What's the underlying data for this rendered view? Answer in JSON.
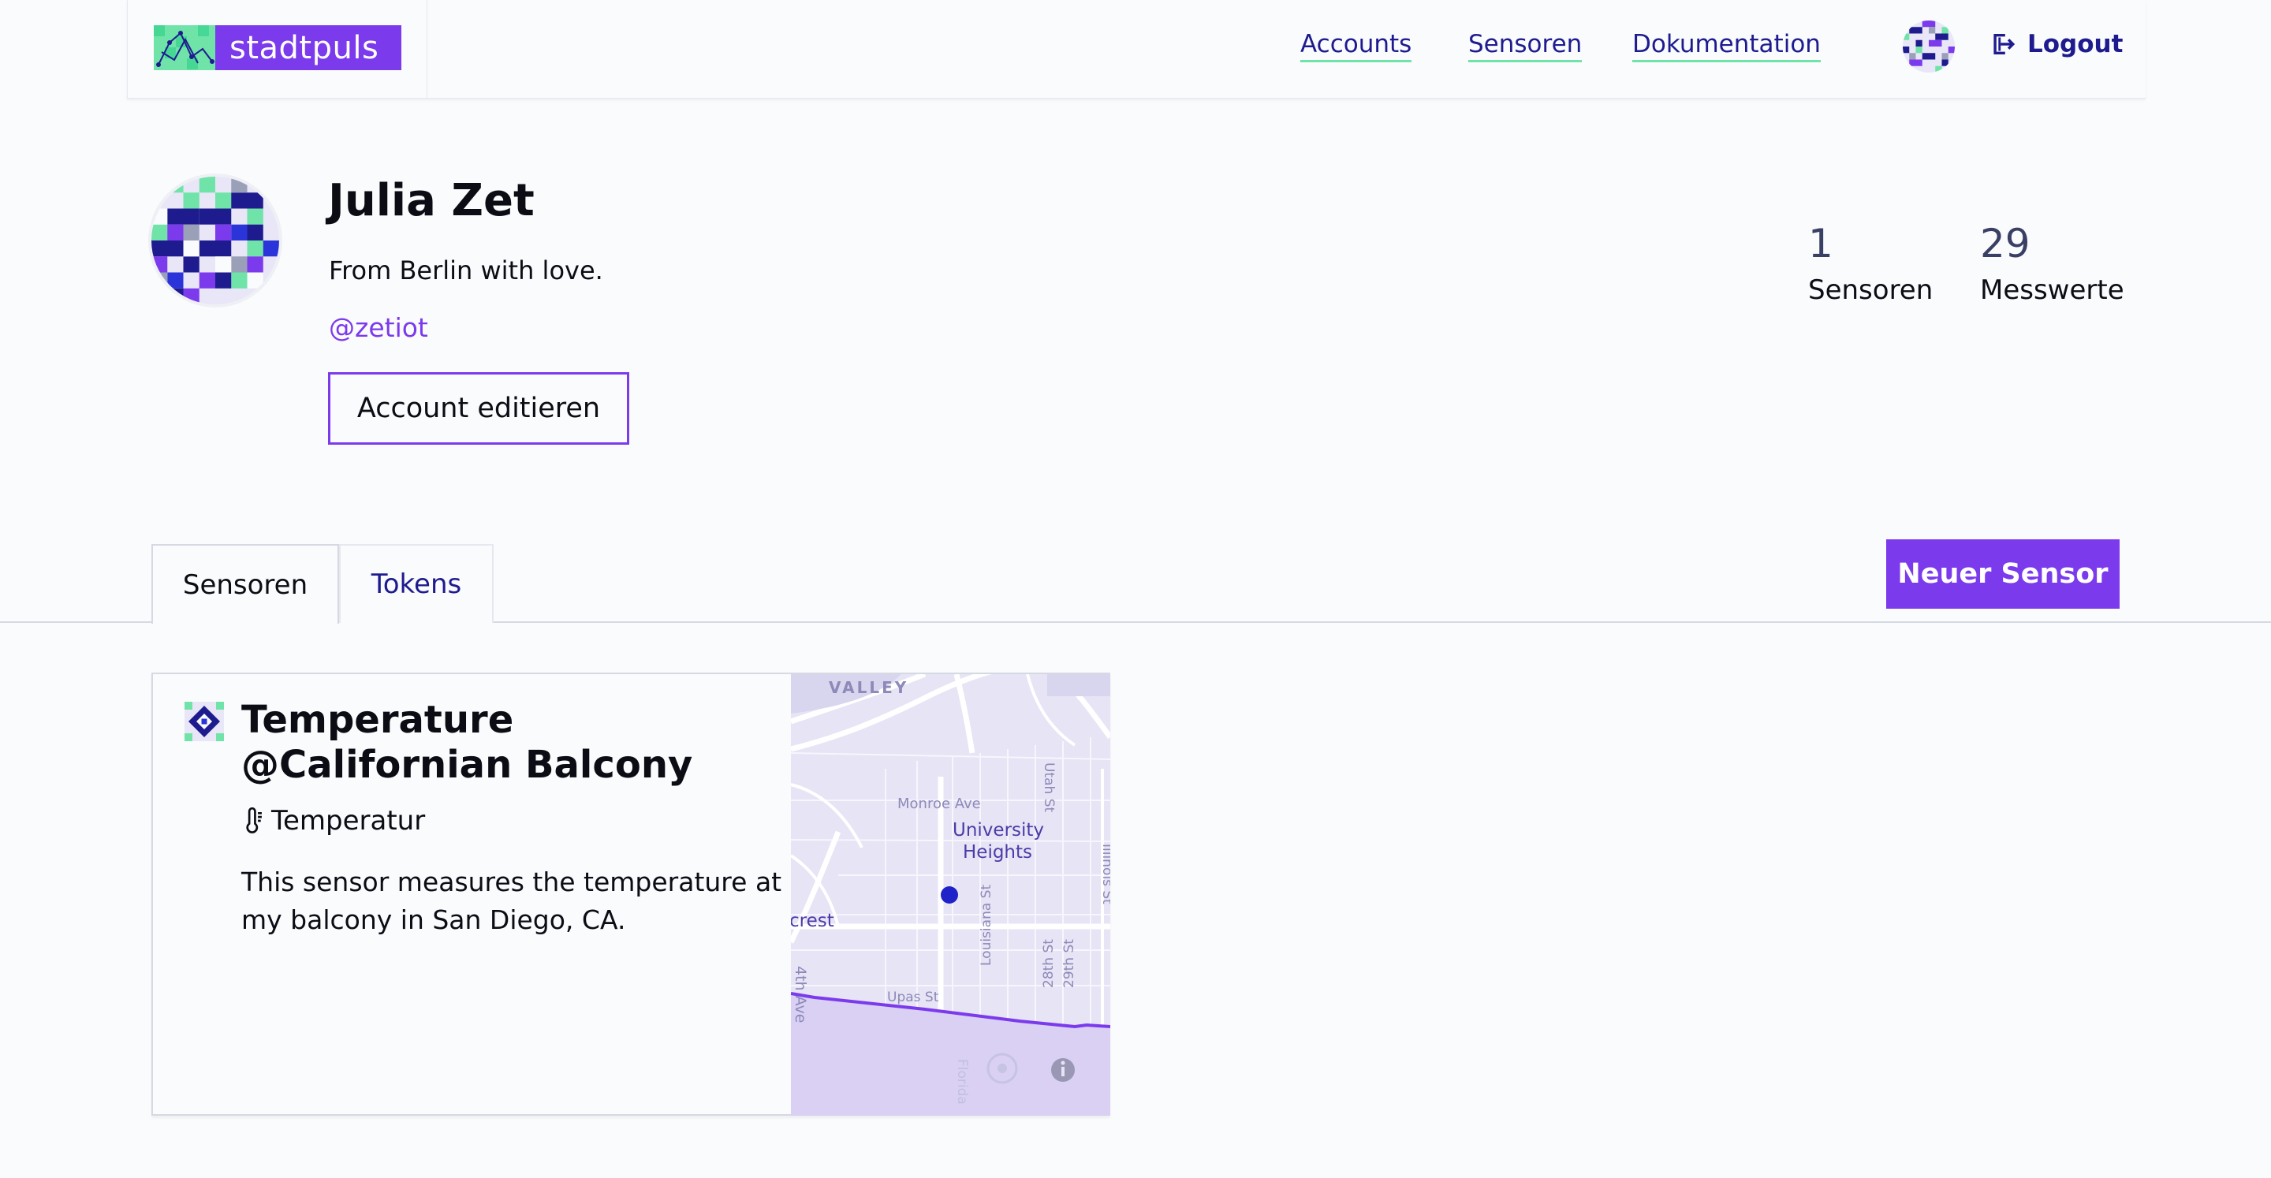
{
  "app": {
    "logo_text": "stadtpuls"
  },
  "nav": {
    "accounts": "Accounts",
    "sensors": "Sensoren",
    "docs": "Dokumentation",
    "logout": "Logout"
  },
  "profile": {
    "name": "Julia Zet",
    "bio": "From Berlin with love.",
    "handle": "@zetiot",
    "edit_label": "Account editieren"
  },
  "stats": [
    {
      "value": "1",
      "label": "Sensoren"
    },
    {
      "value": "29",
      "label": "Messwerte"
    }
  ],
  "tabs": [
    {
      "label": "Sensoren",
      "active": true
    },
    {
      "label": "Tokens",
      "active": false
    }
  ],
  "new_sensor_label": "Neuer Sensor",
  "sensor_card": {
    "title": "Temperature @Californian Balcony",
    "type": "Temperatur",
    "description": "This sensor measures the temperature at my balcony in San Diego, CA.",
    "map": {
      "labels": {
        "valley": "VALLEY",
        "monroe": "Monroe Ave",
        "utah": "Utah St",
        "university1": "University",
        "university2": "Heights",
        "illinois": "Illinois St",
        "crest": "crest",
        "louisiana": "Louisiana St",
        "st28": "28th St",
        "st29": "29th St",
        "ave4": "4th Ave",
        "upas": "Upas St",
        "florida": "Florida"
      }
    }
  },
  "colors": {
    "accent": "#7c3aed",
    "nav": "#1e1b8f",
    "mint": "#6fe3a8",
    "dark": "#0c0c14"
  }
}
